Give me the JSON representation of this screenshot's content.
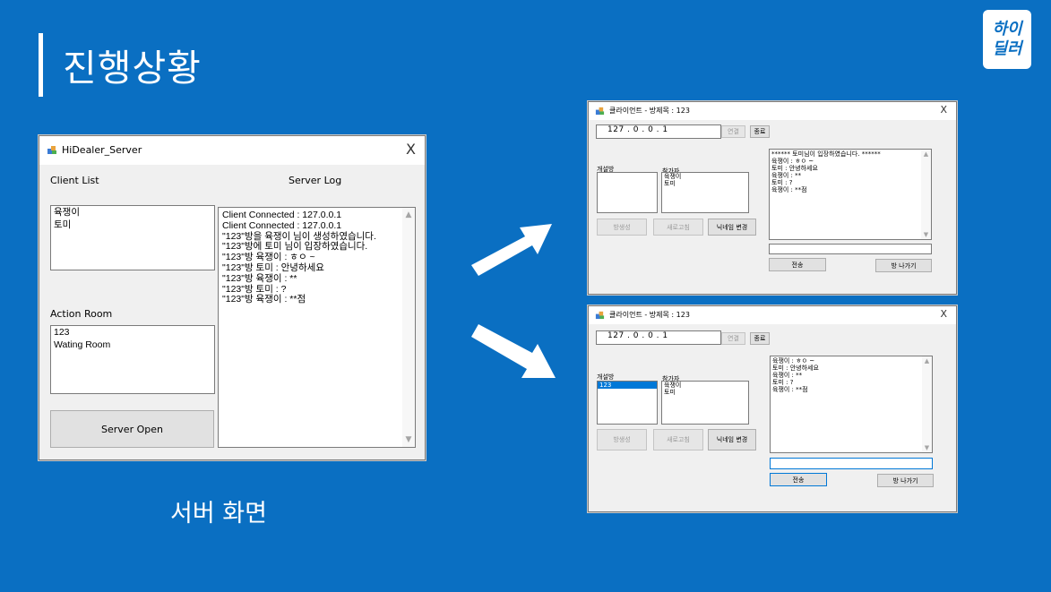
{
  "slide": {
    "title": "진행상황",
    "caption": "서버 화면",
    "logo_line1": "하이",
    "logo_line2": "딜러"
  },
  "server_window": {
    "title": "HiDealer_Server",
    "close": "X",
    "client_list_label": "Client List",
    "server_log_label": "Server Log",
    "clients": [
      "육쟁이",
      "토미"
    ],
    "action_room_label": "Action Room",
    "rooms": [
      "123",
      "Wating Room"
    ],
    "open_button": "Server Open",
    "log": [
      "Client Connected : 127.0.0.1",
      "Client Connected : 127.0.0.1",
      "\"123\"방을 육쟁이 님이 생성하였습니다.",
      "\"123\"방에 토미 님이 입장하였습니다.",
      "\"123\"방 육쟁이 : ㅎㅇ ~",
      "\"123\"방 토미 : 안녕하세요",
      "\"123\"방 육쟁이 : **",
      "\"123\"방 토미 : ?",
      "\"123\"방 육쟁이 : **점"
    ]
  },
  "client_top": {
    "title": "클라이언트 - 방제목 : 123",
    "close": "X",
    "ip": "127 . 0 . 0 . 1",
    "connect": "연결",
    "quit": "종료",
    "room_list_label": "개설방",
    "participants_label": "참가자",
    "rooms": [],
    "participants": [
      "육쟁이",
      "토미"
    ],
    "create_room": "방생성",
    "refresh": "새로고침",
    "nickname": "닉네임 변경",
    "chat": [
      "****** 토미님이 입장하였습니다. ******",
      "육쟁이 : ㅎㅇ ~",
      "토미 : 안녕하세요",
      "육쟁이 : **",
      "토미 : ?",
      "육쟁이 : **점"
    ],
    "input_value": "",
    "send": "전송",
    "leave": "방 나가기"
  },
  "client_bottom": {
    "title": "클라이언트 - 방제목 : 123",
    "close": "X",
    "ip": "127 . 0 . 0 . 1",
    "connect": "연결",
    "quit": "종료",
    "room_list_label": "개설방",
    "participants_label": "참가자",
    "rooms": [
      "123"
    ],
    "participants": [
      "육쟁이",
      "토미"
    ],
    "create_room": "방생성",
    "refresh": "새로고침",
    "nickname": "닉네임 변경",
    "chat": [
      "육쟁이 : ㅎㅇ ~",
      "토미 : 안녕하세요",
      "육쟁이 : **",
      "토미 : ?",
      "육쟁이 : **점"
    ],
    "input_value": "",
    "send": "전송",
    "leave": "방 나가기"
  },
  "colors": {
    "background": "#0a6fc2",
    "selection": "#0078d7"
  }
}
